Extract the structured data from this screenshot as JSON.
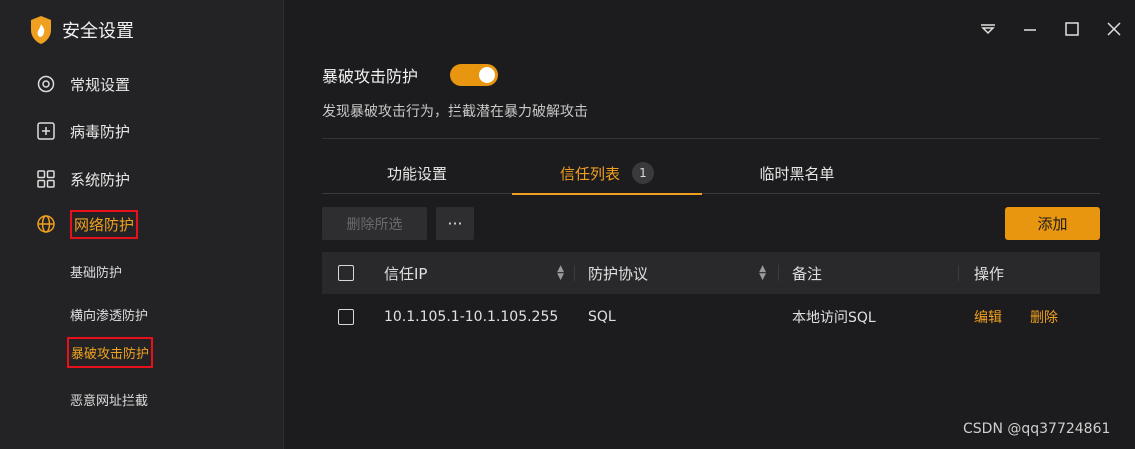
{
  "app": {
    "title": "安全设置",
    "brand_color": "#f0a020"
  },
  "sidebar": {
    "items": [
      {
        "label": "常规设置",
        "icon": "gear-icon"
      },
      {
        "label": "病毒防护",
        "icon": "plus-box-icon"
      },
      {
        "label": "系统防护",
        "icon": "grid-icon"
      },
      {
        "label": "网络防护",
        "icon": "globe-icon",
        "active": true
      }
    ],
    "sub_items": [
      {
        "label": "基础防护"
      },
      {
        "label": "横向渗透防护"
      },
      {
        "label": "暴破攻击防护",
        "active": true
      },
      {
        "label": "恶意网址拦截"
      }
    ]
  },
  "window_controls": [
    "dropdown-icon",
    "minimize-icon",
    "maximize-icon",
    "close-icon"
  ],
  "feature": {
    "title": "暴破攻击防护",
    "enabled": true,
    "description": "发现暴破攻击行为，拦截潜在暴力破解攻击"
  },
  "tabs": [
    {
      "label": "功能设置"
    },
    {
      "label": "信任列表",
      "badge": "1",
      "active": true
    },
    {
      "label": "临时黑名单"
    }
  ],
  "toolbar": {
    "delete_selected": "删除所选",
    "more": "···",
    "add": "添加"
  },
  "table": {
    "headers": [
      "信任IP",
      "防护协议",
      "备注",
      "操作"
    ],
    "rows": [
      {
        "ip": "10.1.105.1-10.1.105.255",
        "protocol": "SQL",
        "note": "本地访问SQL",
        "edit": "编辑",
        "delete": "删除"
      }
    ]
  },
  "watermark": "CSDN @qq37724861"
}
